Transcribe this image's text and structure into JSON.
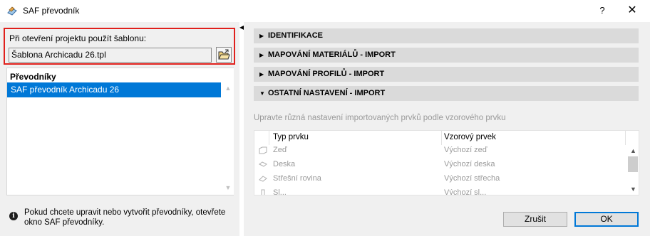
{
  "window": {
    "title": "SAF převodník",
    "help_label": "?",
    "close_label": "✕"
  },
  "left": {
    "template_label": "Při otevření projektu použít šablonu:",
    "template_value": "Šablona Archicadu 26.tpl",
    "converters_header": "Převodníky",
    "converters": [
      "SAF převodník Archicadu 26"
    ],
    "info_text": "Pokud chcete upravit nebo vytvořit převodníky, otevřete okno SAF převodníky."
  },
  "right": {
    "sections": [
      {
        "label": "IDENTIFIKACE",
        "expanded": false
      },
      {
        "label": "MAPOVÁNÍ MATERIÁLŮ - IMPORT",
        "expanded": false
      },
      {
        "label": "MAPOVÁNÍ PROFILŮ - IMPORT",
        "expanded": false
      },
      {
        "label": "OSTATNÍ NASTAVENÍ - IMPORT",
        "expanded": true
      }
    ],
    "hint": "Upravte různá nastavení importovaných prvků podle vzorového prvku",
    "table": {
      "col1": "Typ prvku",
      "col2": "Vzorový prvek",
      "rows": [
        {
          "type": "Zeď",
          "sample": "Výchozí zeď",
          "icon": "wall-icon"
        },
        {
          "type": "Deska",
          "sample": "Výchozí deska",
          "icon": "slab-icon"
        },
        {
          "type": "Střešní rovina",
          "sample": "Výchozí střecha",
          "icon": "roof-icon"
        },
        {
          "type": "Sl...",
          "sample": "Výchozí sl...",
          "icon": "column-icon"
        }
      ]
    },
    "cancel_label": "Zrušit",
    "ok_label": "OK"
  },
  "colors": {
    "selection": "#0078d7",
    "highlight_border": "#e0201c",
    "section_bg": "#dadada",
    "panel_bg": "#f0f0f0"
  }
}
